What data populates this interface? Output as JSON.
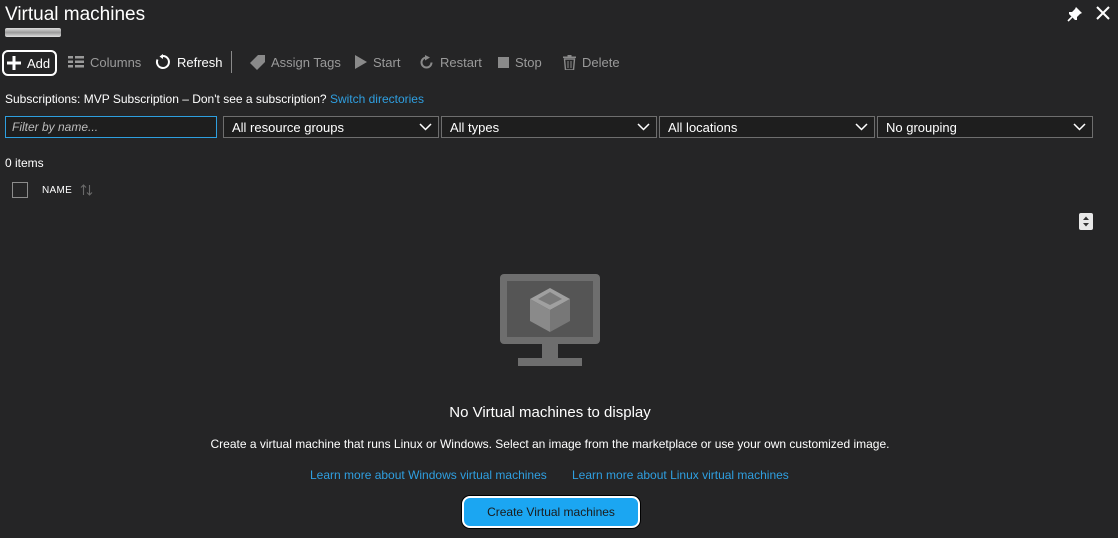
{
  "header": {
    "title": "Virtual machines"
  },
  "toolbar": {
    "add": "Add",
    "columns": "Columns",
    "refresh": "Refresh",
    "assign_tags": "Assign Tags",
    "start": "Start",
    "restart": "Restart",
    "stop": "Stop",
    "delete": "Delete"
  },
  "subscriptions": {
    "label": "Subscriptions:",
    "value": "MVP Subscription – Don't see a subscription?",
    "link": "Switch directories"
  },
  "filters": {
    "name_placeholder": "Filter by name...",
    "resource_groups": "All resource groups",
    "types": "All types",
    "locations": "All locations",
    "grouping": "No grouping"
  },
  "list": {
    "count": "0 items",
    "column_name": "NAME"
  },
  "empty_state": {
    "title": "No Virtual machines to display",
    "description": "Create a virtual machine that runs Linux or Windows. Select an image from the marketplace or use your own customized image.",
    "learn_windows": "Learn more about Windows virtual machines",
    "learn_linux": "Learn more about Linux virtual machines",
    "create_button": "Create Virtual machines"
  },
  "colors": {
    "background": "#252526",
    "accent_link": "#2f9fe0",
    "button_primary": "#1ba6f2"
  },
  "icons": [
    "pin-icon",
    "close-icon",
    "plus-icon",
    "columns-icon",
    "refresh-icon",
    "tag-icon",
    "play-icon",
    "restart-icon",
    "stop-icon",
    "trash-icon",
    "chevron-down-icon",
    "sort-icon",
    "virtual-machine-icon"
  ]
}
